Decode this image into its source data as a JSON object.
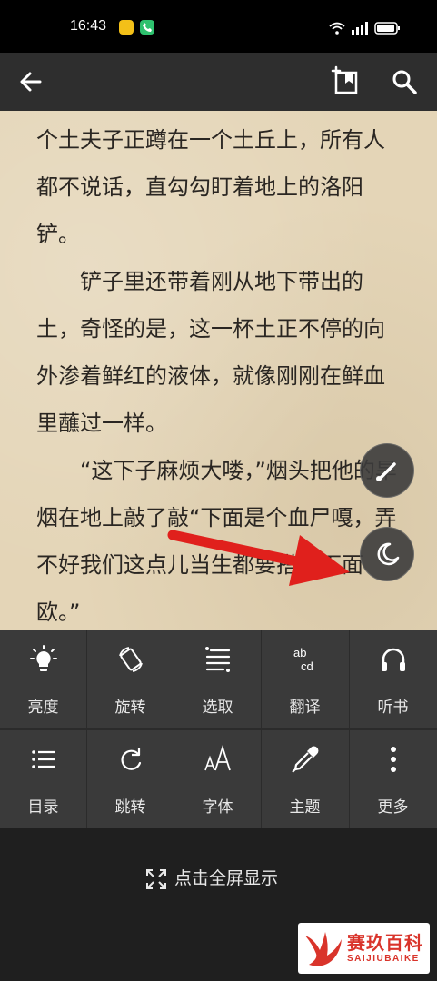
{
  "status_bar": {
    "time": "16:43",
    "battery_level": 0.9,
    "icons": [
      "app-notification-icon",
      "phone-notification-icon",
      "wifi-icon",
      "signal-icon",
      "battery-icon"
    ]
  },
  "toolbar": {
    "back_icon": "arrow-left-icon",
    "bookmark_icon": "add-bookmark-icon",
    "search_icon": "search-icon"
  },
  "content": {
    "paragraphs": [
      "个土夫子正蹲在一个土丘上，所有人都不说话，直勾勾盯着地上的洛阳铲。",
      "　　铲子里还带着刚从地下带出的土，奇怪的是，这一杯土正不停的向外渗着鲜红的液体，就像刚刚在鲜血里蘸过一样。",
      "　　“这下子麻烦大喽，”烟头把他的旱烟在地上敲了敲“下面是个血尸嘎，弄不好我们这点儿当生都要搭在下面欧。”"
    ]
  },
  "annotation": {
    "arrow_color": "#e0201c"
  },
  "floating": {
    "brush_icon": "brush-icon",
    "night_icon": "moon-icon"
  },
  "menu": {
    "row1": [
      {
        "label": "亮度",
        "icon": "bulb-icon"
      },
      {
        "label": "旋转",
        "icon": "rotate-icon"
      },
      {
        "label": "选取",
        "icon": "select-text-icon"
      },
      {
        "label": "翻译",
        "icon": "translate-icon"
      },
      {
        "label": "听书",
        "icon": "headphones-icon"
      }
    ],
    "row2": [
      {
        "label": "目录",
        "icon": "list-icon"
      },
      {
        "label": "跳转",
        "icon": "redo-icon"
      },
      {
        "label": "字体",
        "icon": "font-icon"
      },
      {
        "label": "主题",
        "icon": "dropper-icon"
      },
      {
        "label": "更多",
        "icon": "more-vertical-icon"
      }
    ]
  },
  "bottom": {
    "fullscreen_label": "点击全屏显示",
    "fullscreen_icon": "expand-icon"
  },
  "watermark": {
    "title": "赛玖百科",
    "subtitle": "SAIJIUBAIKE",
    "brand_color": "#d9342b"
  }
}
